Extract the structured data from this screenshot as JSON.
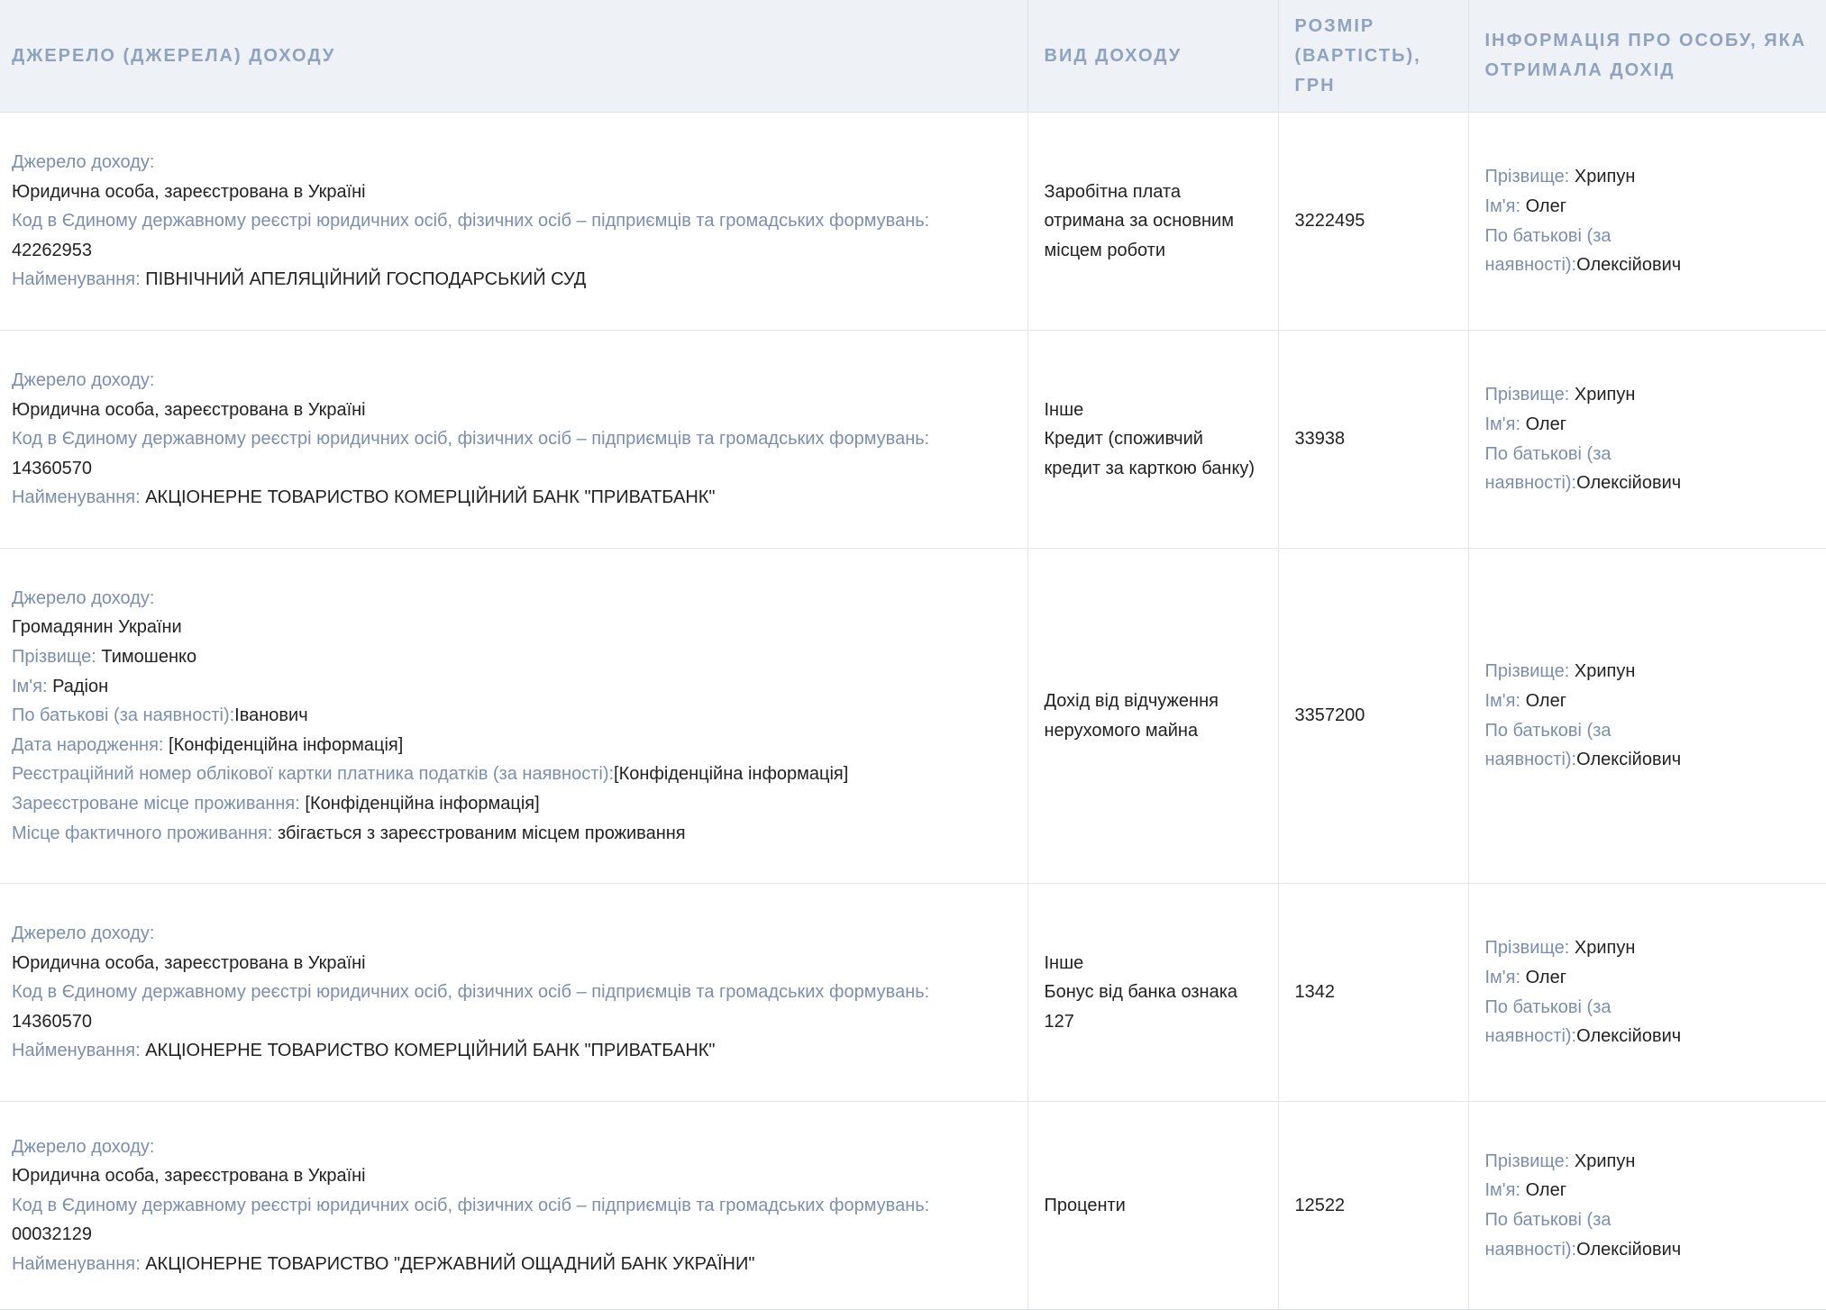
{
  "header": {
    "col_source": "Джерело (джерела) доходу",
    "col_type": "Вид доходу",
    "col_amount": "Розмір (вартість), грн",
    "col_person": "Інформація про особу, яка отримала дохід"
  },
  "labels": {
    "source": "Джерело доходу:",
    "code": "Код в Єдиному державному реєстрі юридичних осіб, фізичних осіб – підприємців та громадських формувань:",
    "name": "Найменування:",
    "surname": "Прізвище:",
    "firstname": "Ім'я:",
    "patronymic": "По батькові (за наявності):",
    "patronymic_a": "По батькові (за",
    "patronymic_b": "наявності):",
    "birthdate": "Дата народження:",
    "tax_id": "Реєстраційний номер облікової картки платника податків (за наявності):",
    "reg_address": "Зареєстроване місце проживання:",
    "actual_address": "Місце фактичного проживання:"
  },
  "rows": [
    {
      "source_type": "Юридична особа, зареєстрована в Україні",
      "code": "42262953",
      "name": "ПІВНІЧНИЙ АПЕЛЯЦІЙНИЙ ГОСПОДАРСЬКИЙ СУД",
      "income_type": "Заробітна плата отримана за основним місцем роботи",
      "amount": "3222495",
      "person": {
        "surname": "Хрипун",
        "firstname": "Олег",
        "patronymic": "Олексійович"
      }
    },
    {
      "source_type": "Юридична особа, зареєстрована в Україні",
      "code": "14360570",
      "name": "АКЦІОНЕРНЕ ТОВАРИСТВО КОМЕРЦІЙНИЙ БАНК \"ПРИВАТБАНК\"",
      "income_type": "Інше",
      "income_detail": "Кредит (споживчий кредит за карткою банку)",
      "amount": "33938",
      "person": {
        "surname": "Хрипун",
        "firstname": "Олег",
        "patronymic": "Олексійович"
      }
    },
    {
      "source_type": "Громадянин України",
      "surname": "Тимошенко",
      "firstname": "Радіон",
      "patronymic": "Іванович",
      "birthdate": "[Конфіденційна інформація]",
      "tax_id": "[Конфіденційна інформація]",
      "reg_address": "[Конфіденційна інформація]",
      "actual_address": "збігається з зареєстрованим місцем проживання",
      "income_type": "Дохід від відчуження нерухомого майна",
      "amount": "3357200",
      "person": {
        "surname": "Хрипун",
        "firstname": "Олег",
        "patronymic": "Олексійович"
      }
    },
    {
      "source_type": "Юридична особа, зареєстрована в Україні",
      "code": "14360570",
      "name": "АКЦІОНЕРНЕ ТОВАРИСТВО КОМЕРЦІЙНИЙ БАНК \"ПРИВАТБАНК\"",
      "income_type": "Інше",
      "income_detail": "Бонус від банка ознака 127",
      "amount": "1342",
      "person": {
        "surname": "Хрипун",
        "firstname": "Олег",
        "patronymic": "Олексійович"
      }
    },
    {
      "source_type": "Юридична особа, зареєстрована в Україні",
      "code": "00032129",
      "name": "АКЦІОНЕРНЕ ТОВАРИСТВО \"ДЕРЖАВНИЙ ОЩАДНИЙ БАНК УКРАЇНИ\"",
      "income_type": "Проценти",
      "amount": "12522",
      "person": {
        "surname": "Хрипун",
        "firstname": "Олег",
        "patronymic": "Олексійович"
      }
    }
  ]
}
